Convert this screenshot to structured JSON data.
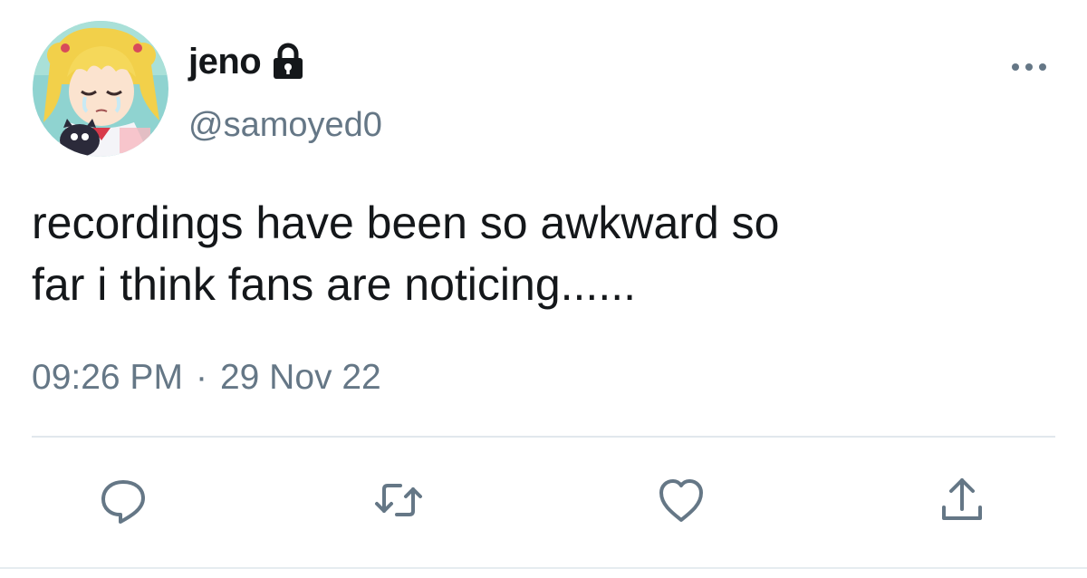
{
  "tweet": {
    "display_name": "jeno",
    "handle": "@samoyed0",
    "text_line1": "recordings have been so awkward so",
    "text_line2": "far i think fans are noticing......",
    "time": "09:26 PM",
    "separator": "·",
    "date": "29 Nov 22",
    "protected": true
  },
  "icons": {
    "lock": "lock-icon",
    "more": "more-dots-icon",
    "reply": "reply-icon",
    "retweet": "retweet-icon",
    "like": "heart-icon",
    "share": "share-icon"
  },
  "colors": {
    "text": "#14171a",
    "secondary": "#657786",
    "divider": "#e1e8ed"
  }
}
